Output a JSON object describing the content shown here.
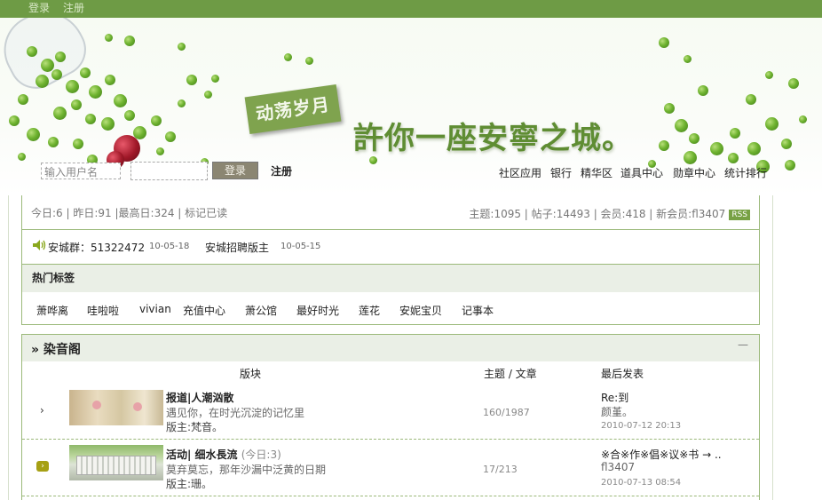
{
  "topbar": {
    "login": "登录",
    "register": "注册"
  },
  "banner": {
    "stamp": "动荡岁月",
    "slogan": "許你一座安寧之城。",
    "login_form": {
      "username_placeholder": "输入用户名",
      "password_value": "",
      "login_button": "登录",
      "register_link": "注册"
    },
    "nav": [
      "社区应用",
      "银行",
      "精华区",
      "道具中心",
      "勋章中心",
      "统计排行"
    ]
  },
  "stats": {
    "left": "今日:6 | 昨日:91 |最高日:324 | 标记已读",
    "right": "主题:1095 | 帖子:14493 | 会员:418 | 新会员:fl3407",
    "rss": "RSS"
  },
  "announcements": [
    {
      "text": "安城群：51322472",
      "date": "10-05-18"
    },
    {
      "text": "安城招聘版主",
      "date": "10-05-15"
    }
  ],
  "hot_tags": {
    "title": "热门标签",
    "tags": [
      "萧哗离",
      "哇啦啦",
      "vivian",
      "充值中心",
      "萧公馆",
      "最好时光",
      "莲花",
      "安妮宝贝",
      "记事本"
    ]
  },
  "forum": {
    "title": "» 染音阁",
    "collapse": "—",
    "columns": {
      "board": "版块",
      "topics": "主题 / 文章",
      "last": "最后发表"
    },
    "rows": [
      {
        "title": "报道|人潮汹散",
        "today": "",
        "desc": "遇见你，在时光沉淀的记忆里",
        "moderator": "版主:梵音。",
        "counts": "160/1987",
        "last_title": "Re:到",
        "last_user": "颜堇。",
        "last_date": "2010-07-12 20:13"
      },
      {
        "title": "活动| 细水長流",
        "today": "(今日:3)",
        "desc": "莫弃莫忘，那年沙漏中泛黄的日期",
        "moderator": "版主:珊。",
        "counts": "17/213",
        "last_title": "※合※作※倡※议※书 → ..",
        "last_user": "fl3407",
        "last_date": "2010-07-13 08:54"
      }
    ]
  }
}
